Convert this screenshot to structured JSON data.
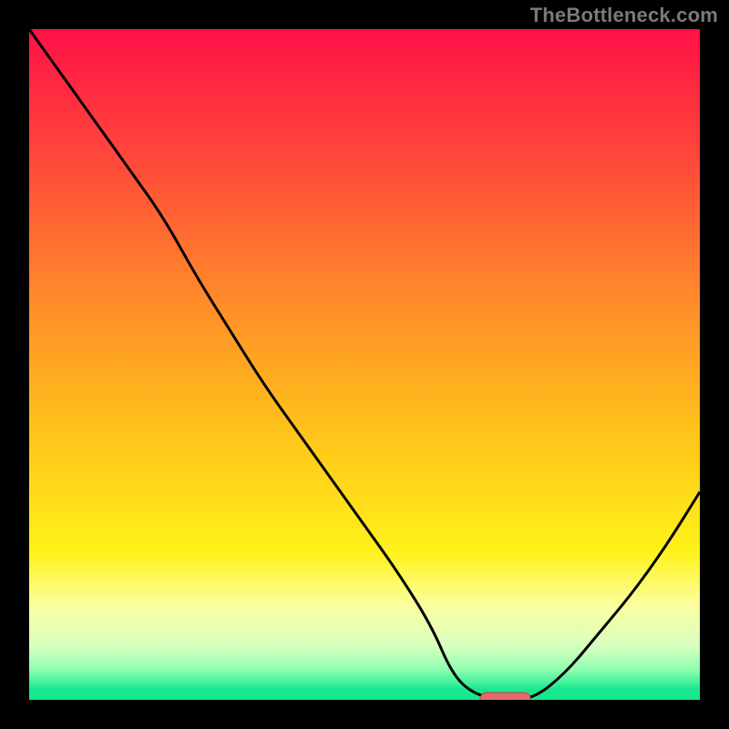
{
  "watermark": "TheBottleneck.com",
  "colors": {
    "frame": "#000000",
    "curve": "#000000",
    "marker_fill": "#e26a6a",
    "marker_stroke": "#b34a4a",
    "gradient_stops": [
      {
        "offset": 0.0,
        "color": "#ff1147"
      },
      {
        "offset": 0.2,
        "color": "#ff4a3a"
      },
      {
        "offset": 0.4,
        "color": "#ff8a2a"
      },
      {
        "offset": 0.6,
        "color": "#ffc31a"
      },
      {
        "offset": 0.78,
        "color": "#fff21a"
      },
      {
        "offset": 0.86,
        "color": "#fbffa0"
      },
      {
        "offset": 0.92,
        "color": "#d8ffc0"
      },
      {
        "offset": 0.955,
        "color": "#8effb0"
      },
      {
        "offset": 0.985,
        "color": "#17e88e"
      },
      {
        "offset": 1.0,
        "color": "#17e88e"
      }
    ]
  },
  "chart_data": {
    "type": "line",
    "title": "",
    "xlabel": "",
    "ylabel": "",
    "xlim": [
      0,
      100
    ],
    "ylim": [
      0,
      100
    ],
    "grid": false,
    "series": [
      {
        "name": "bottleneck-curve",
        "x": [
          0,
          5,
          10,
          15,
          20,
          25,
          30,
          35,
          40,
          45,
          50,
          55,
          60,
          63,
          66,
          70,
          75,
          80,
          85,
          90,
          95,
          100
        ],
        "y": [
          100,
          93,
          86,
          79,
          72,
          63,
          55,
          47,
          40,
          33,
          26,
          19,
          11,
          4,
          1,
          0,
          0,
          4,
          10,
          16,
          23,
          31
        ]
      }
    ],
    "marker": {
      "x_center": 71,
      "width": 7.5,
      "y": 0
    }
  }
}
